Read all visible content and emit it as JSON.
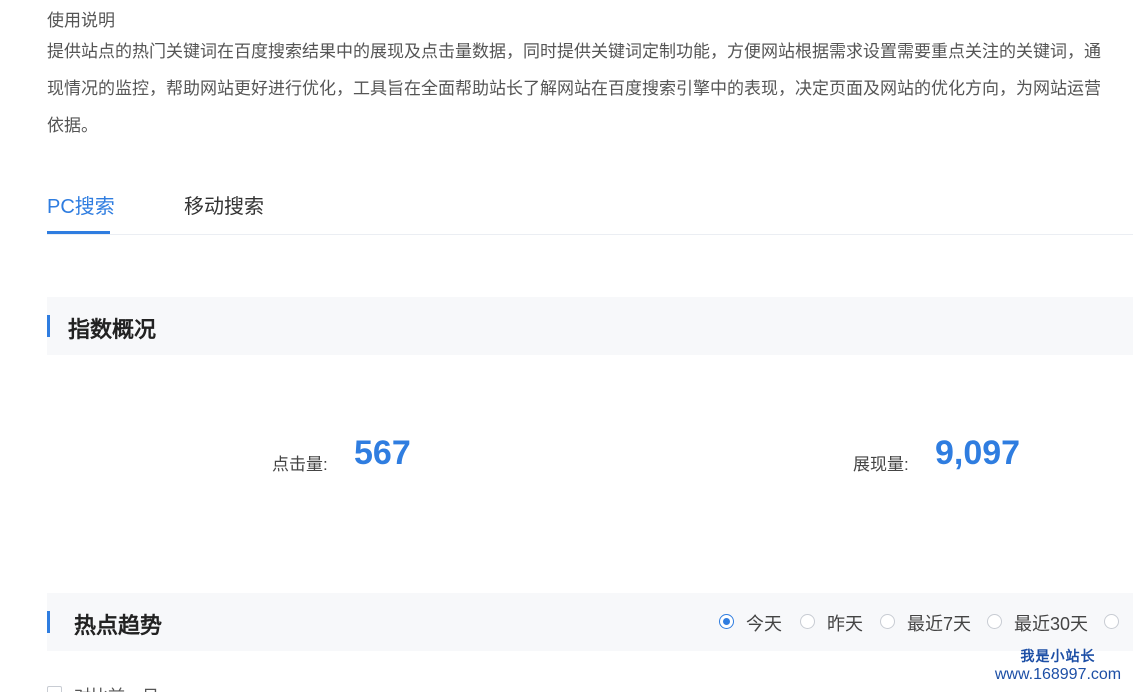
{
  "usage": {
    "title": "使用说明",
    "lines": [
      "提供站点的热门关键词在百度搜索结果中的展现及点击量数据，同时提供关键词定制功能，方便网站根据需求设置需要重点关注的关键词，通",
      "现情况的监控，帮助网站更好进行优化，工具旨在全面帮助站长了解网站在百度搜索引擎中的表现，决定页面及网站的优化方向，为网站运营",
      "依据。"
    ]
  },
  "tabs": [
    {
      "label": "PC搜索",
      "active": true
    },
    {
      "label": "移动搜索",
      "active": false
    }
  ],
  "overview": {
    "title": "指数概况",
    "clicks_label": "点击量:",
    "clicks_value": "567",
    "impressions_label": "展现量:",
    "impressions_value": "9,097"
  },
  "trend": {
    "title": "热点趋势",
    "ranges": [
      {
        "label": "今天",
        "checked": true
      },
      {
        "label": "昨天",
        "checked": false
      },
      {
        "label": "最近7天",
        "checked": false
      },
      {
        "label": "最近30天",
        "checked": false
      }
    ],
    "compare_label": "对比前一日"
  },
  "watermark": {
    "title": "我是小站长",
    "url": "www.168997.com"
  },
  "colors": {
    "accent": "#2f7de0",
    "section_bg": "#f7f8fa"
  }
}
